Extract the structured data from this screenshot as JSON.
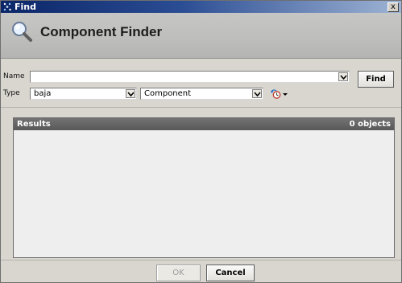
{
  "window": {
    "title": "Find",
    "close_label": "x"
  },
  "header": {
    "title": "Component Finder",
    "icon": "magnifier-icon"
  },
  "form": {
    "name_label": "Name",
    "name_value": "",
    "find_label": "Find",
    "type_label": "Type",
    "type_module": "baja",
    "type_component": "Component",
    "options_icon": "history-icon"
  },
  "results": {
    "title": "Results",
    "count": "0 objects",
    "rows": []
  },
  "footer": {
    "ok_label": "OK",
    "cancel_label": "Cancel"
  },
  "colors": {
    "title_bar_start": "#0b2568",
    "results_header": "#646464",
    "dialog_bg": "#d9d6d0"
  }
}
